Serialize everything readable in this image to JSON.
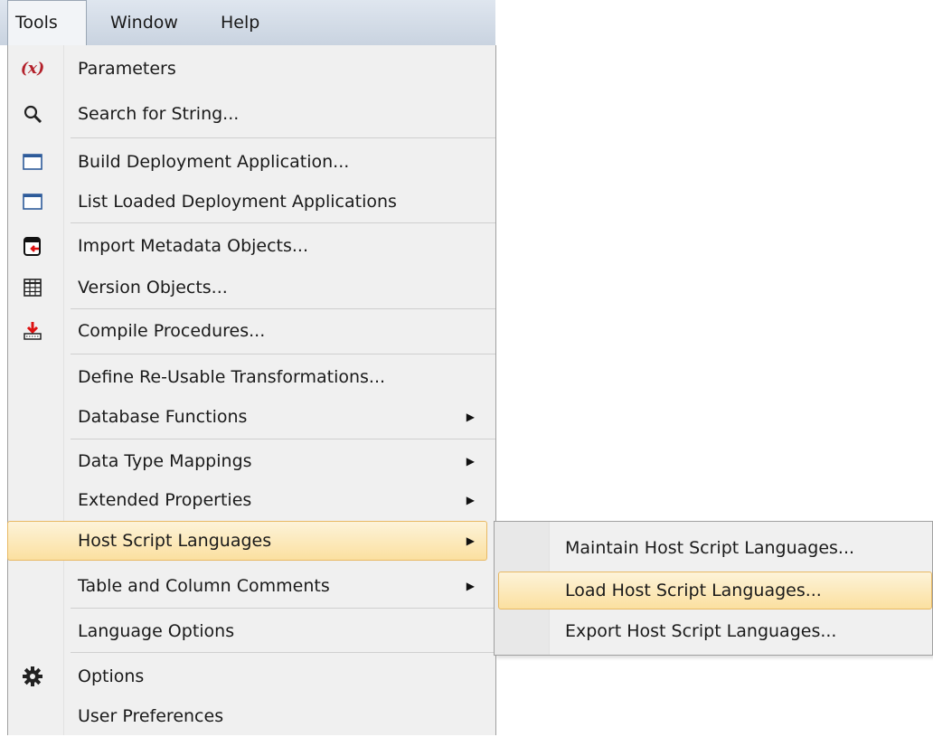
{
  "menubar": {
    "items": [
      {
        "label": "Tools",
        "active": true
      },
      {
        "label": "Window",
        "active": false
      },
      {
        "label": "Help",
        "active": false
      }
    ]
  },
  "tools_menu": {
    "items": [
      {
        "label": "Parameters",
        "icon": "variable-x-icon"
      },
      {
        "label": "Search for String...",
        "icon": "magnifier-icon"
      },
      {
        "label": "Build Deployment Application...",
        "icon": "window-icon"
      },
      {
        "label": "List Loaded Deployment Applications",
        "icon": "window-icon"
      },
      {
        "label": "Import Metadata Objects...",
        "icon": "import-database-icon"
      },
      {
        "label": "Version Objects...",
        "icon": "grid-icon"
      },
      {
        "label": "Compile Procedures...",
        "icon": "compile-download-icon"
      },
      {
        "label": "Define Re-Usable Transformations...",
        "icon": null
      },
      {
        "label": "Database Functions",
        "submenu": true
      },
      {
        "label": "Data Type Mappings",
        "submenu": true
      },
      {
        "label": "Extended Properties",
        "submenu": true
      },
      {
        "label": "Host Script Languages",
        "submenu": true,
        "highlighted": true
      },
      {
        "label": "Table and Column Comments",
        "submenu": true
      },
      {
        "label": "Language Options"
      },
      {
        "label": "Options",
        "icon": "gear-icon"
      },
      {
        "label": "User Preferences"
      }
    ]
  },
  "host_script_submenu": {
    "items": [
      {
        "label": "Maintain Host Script Languages..."
      },
      {
        "label": "Load Host Script Languages...",
        "highlighted": true
      },
      {
        "label": "Export Host Script Languages..."
      }
    ]
  },
  "colors": {
    "highlight_fill": "#fbe0a0",
    "highlight_border": "#e8b964",
    "menu_bg": "#f0f0f0",
    "menubar_bg": "#c9d3e0"
  }
}
